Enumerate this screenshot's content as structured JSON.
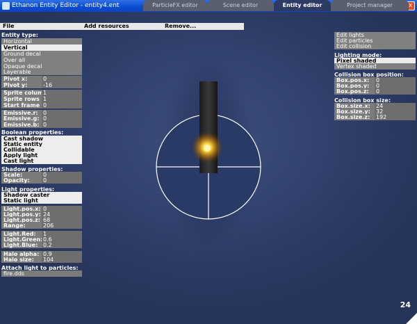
{
  "window": {
    "title": "Ethanon Entity Editor - entity4.ent",
    "minimize": "_",
    "maximize": "□",
    "close": "x"
  },
  "tabs": [
    {
      "label": "ParticleFX editor",
      "active": false
    },
    {
      "label": "Scene editor",
      "active": false
    },
    {
      "label": "Entity editor",
      "active": true
    },
    {
      "label": "Project manager",
      "active": false
    }
  ],
  "menu": {
    "file": "File",
    "add_resources": "Add resources",
    "remove": "Remove..."
  },
  "entity_type": {
    "header": "Entity type:",
    "options": [
      {
        "label": "Horizontal",
        "selected": false
      },
      {
        "label": "Vertical",
        "selected": true
      },
      {
        "label": "Ground decal",
        "selected": false
      },
      {
        "label": "Over all",
        "selected": false
      },
      {
        "label": "Opaque decal",
        "selected": false
      },
      {
        "label": "Layerable",
        "selected": false
      }
    ]
  },
  "pivot": {
    "x_label": "Pivot x:",
    "x": "0",
    "y_label": "Pivot y:",
    "y": "-16"
  },
  "sprite": {
    "columns_label": "Sprite columns",
    "columns": "1",
    "rows_label": "Sprite rows",
    "rows": "1",
    "start_label": "Start frame",
    "start": "0"
  },
  "emissive": {
    "r_label": "Emissive.r:",
    "r": "0",
    "g_label": "Emissive.g:",
    "g": "0",
    "b_label": "Emissive.b:",
    "b": "0"
  },
  "boolean": {
    "header": "Boolean properties:",
    "options": [
      "Cast shadow",
      "Static entity",
      "Collidable",
      "Apply light",
      "Cast light"
    ]
  },
  "shadow": {
    "header": "Shadow properties:",
    "scale_label": "Scale:",
    "scale": "0",
    "opacity_label": "Opacity:",
    "opacity": "0"
  },
  "light": {
    "header": "Light properties:",
    "options": [
      "Shadow caster",
      "Static light"
    ],
    "pos_x_label": "Light.pos.x:",
    "pos_x": "0",
    "pos_y_label": "Light.pos.y:",
    "pos_y": "24",
    "pos_z_label": "Light.pos.z:",
    "pos_z": "68",
    "range_label": "Range:",
    "range": "206",
    "red_label": "Light.Red:",
    "red": "1",
    "green_label": "Light.Green:",
    "green": "0.6",
    "blue_label": "Light.Blue:",
    "blue": "0.2",
    "halo_alpha_label": "Halo alpha:",
    "halo_alpha": "0.9",
    "halo_size_label": "Halo size:",
    "halo_size": "104"
  },
  "particles": {
    "header": "Attach light to particles:",
    "file": "fire.dds"
  },
  "edit_buttons": [
    "Edit lights",
    "Edit particles",
    "Edit collision"
  ],
  "lighting": {
    "header": "Lighting mode:",
    "options": [
      {
        "label": "Pixel shaded",
        "selected": true
      },
      {
        "label": "Vertex shaded",
        "selected": false
      }
    ]
  },
  "collision_pos": {
    "header": "Collision box position:",
    "x_label": "Box.pos.x:",
    "x": "0",
    "y_label": "Box.pos.y:",
    "y": "0",
    "z_label": "Box.pos.z:",
    "z": "0"
  },
  "collision_size": {
    "header": "Collision box size:",
    "x_label": "Box.size.x:",
    "x": "24",
    "y_label": "Box.size.y:",
    "y": "32",
    "z_label": "Box.size.z:",
    "z": "192"
  },
  "fps": "24",
  "colors": {
    "titlebar": "#0a4bd0",
    "background": "#2c3b66",
    "panel_grey": "#7b7b7b",
    "selected": "#ededed",
    "glow": "#ffd23a"
  }
}
